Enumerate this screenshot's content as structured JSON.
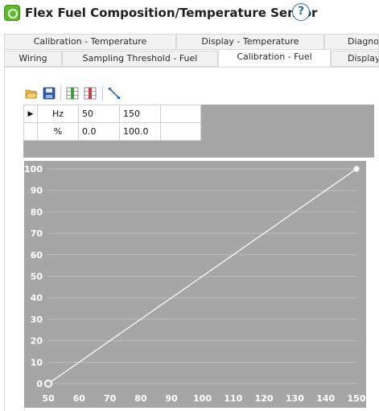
{
  "window": {
    "title": "Flex Fuel Composition/Temperature Sensor",
    "help_label": "?"
  },
  "tabs_row1": [
    {
      "label": "Calibration - Temperature"
    },
    {
      "label": "Display - Temperature"
    },
    {
      "label": "Diagno"
    }
  ],
  "tabs_row2": [
    {
      "label": "Wiring"
    },
    {
      "label": "Sampling Threshold - Fuel"
    },
    {
      "label": "Calibration - Fuel",
      "active": true
    },
    {
      "label": "Display"
    }
  ],
  "toolbar": [
    "open-folder-icon",
    "save-icon",
    "insert-column-icon",
    "delete-column-icon",
    "curve-edit-icon"
  ],
  "table": {
    "rows": [
      {
        "marker": "▶",
        "header": "Hz",
        "cells": [
          "50",
          "150",
          ""
        ]
      },
      {
        "marker": "",
        "header": "%",
        "cells": [
          "0.0",
          "100.0",
          ""
        ]
      }
    ]
  },
  "chart_data": {
    "type": "line",
    "x": [
      50,
      150
    ],
    "y": [
      0,
      100
    ],
    "xlim": [
      50,
      150
    ],
    "ylim": [
      0,
      100
    ],
    "xticks": [
      "50",
      "60",
      "70",
      "80",
      "90",
      "100",
      "110",
      "120",
      "130",
      "140",
      "150"
    ],
    "yticks": [
      "0",
      "10",
      "20",
      "30",
      "40",
      "50",
      "60",
      "70",
      "80",
      "90",
      "100"
    ],
    "grid": true,
    "title": "",
    "xlabel": "",
    "ylabel": "",
    "colors": {
      "background": "#a6a6a6",
      "line": "#ffffff",
      "grid": "#bdbdbd",
      "tick_text": "#ffffff"
    }
  }
}
